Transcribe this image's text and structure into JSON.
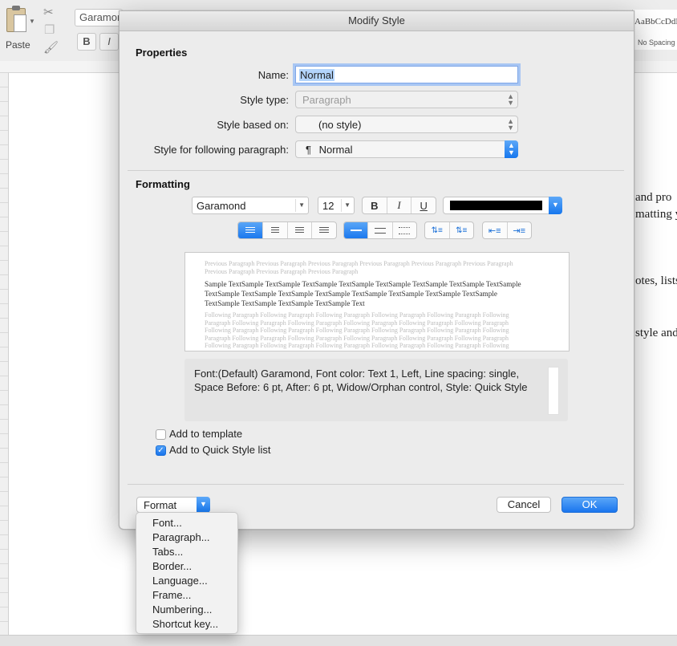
{
  "ribbon": {
    "paste_label": "Paste",
    "font_name": "Garamon",
    "bold_label": "B",
    "italic_label": "I",
    "style_sample": "AaBbCcDdE",
    "style_name": "No Spacing"
  },
  "document": {
    "lines": [
      "and pro",
      "matting y",
      "otes, lists",
      "style and"
    ]
  },
  "dialog": {
    "title": "Modify Style",
    "properties_heading": "Properties",
    "name_label": "Name:",
    "name_value": "Normal",
    "style_type_label": "Style type:",
    "style_type_value": "Paragraph",
    "based_on_label": "Style based on:",
    "based_on_value": "(no style)",
    "following_label": "Style for following paragraph:",
    "following_value": "Normal",
    "paragraph_mark": "¶",
    "formatting_heading": "Formatting",
    "font_value": "Garamond",
    "size_value": "12",
    "bold": "B",
    "italic": "I",
    "underline": "U",
    "font_color": "#000000",
    "alignment_selected": "left",
    "line_spacing_selected": "single",
    "preview": {
      "previous": "Previous Paragraph Previous Paragraph Previous Paragraph Previous Paragraph Previous Paragraph Previous Paragraph Previous Paragraph Previous Paragraph Previous Paragraph",
      "sample": "Sample TextSample TextSample TextSample TextSample TextSample TextSample TextSample TextSample TextSample TextSample TextSample TextSample TextSample TextSample TextSample TextSample TextSample TextSample TextSample TextSample Text",
      "following": "Following Paragraph Following Paragraph Following Paragraph Following Paragraph Following Paragraph Following Paragraph Following Paragraph Following Paragraph Following Paragraph Following Paragraph Following Paragraph Following Paragraph Following Paragraph Following Paragraph Following Paragraph Following Paragraph Following Paragraph Following Paragraph Following Paragraph Following Paragraph Following Paragraph Following Paragraph Following Paragraph Following Paragraph Following Paragraph Following Paragraph Following Paragraph Following Paragraph Following Paragraph Following Paragraph Following Paragraph Following Paragraph Following Paragraph Following Paragraph Following Paragraph Following Paragraph"
    },
    "description": "Font:(Default) Garamond, Font color: Text 1, Left, Line spacing:  single, Space Before:  6 pt, After:  6 pt, Widow/Orphan control, Style: Quick Style",
    "add_to_template_label": "Add to template",
    "add_to_template_checked": false,
    "add_to_quick_style_label": "Add to Quick Style list",
    "add_to_quick_style_checked": true,
    "format_label": "Format",
    "cancel_label": "Cancel",
    "ok_label": "OK"
  },
  "format_menu": {
    "items": [
      "Font...",
      "Paragraph...",
      "Tabs...",
      "Border...",
      "Language...",
      "Frame...",
      "Numbering...",
      "Shortcut key..."
    ]
  },
  "colors": {
    "accent": "#1a75ee",
    "selection": "#b3d4fb"
  }
}
